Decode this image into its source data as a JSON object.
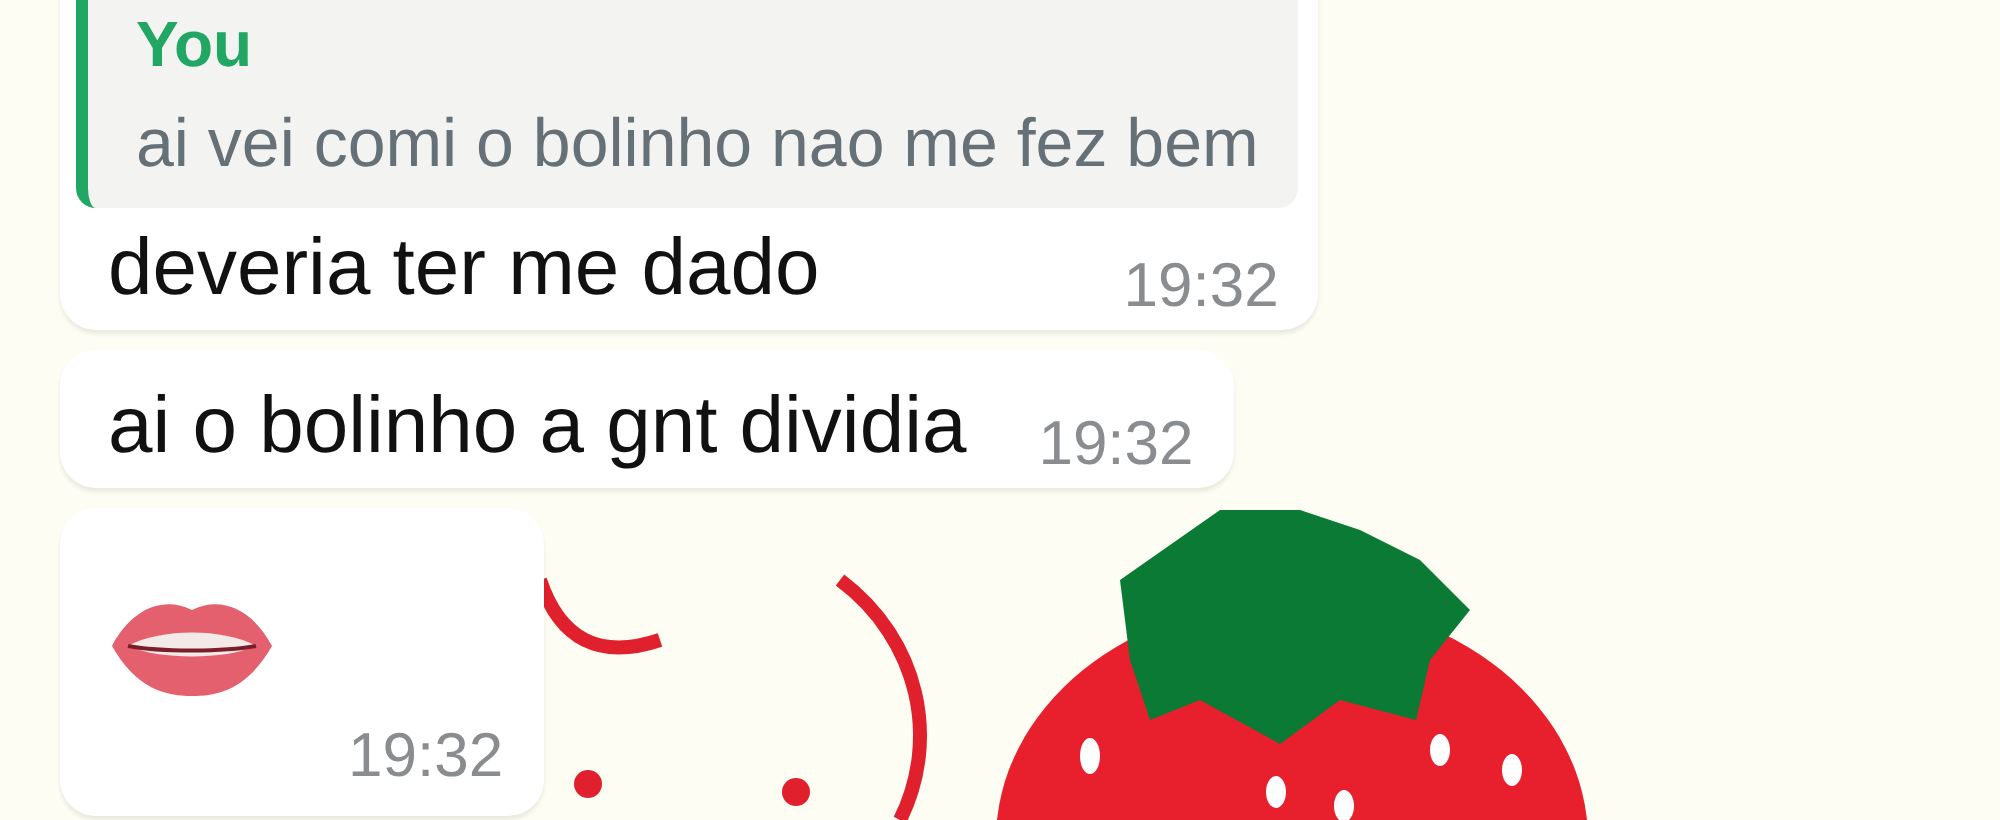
{
  "messages": [
    {
      "kind": "text",
      "quote": {
        "author": "You",
        "text": "ai vei comi o bolinho nao me fez bem"
      },
      "text": "deveria ter me dado",
      "time": "19:32"
    },
    {
      "kind": "text",
      "text": "ai o bolinho a gnt dividia",
      "time": "19:32"
    },
    {
      "kind": "emoji",
      "time": "19:32"
    }
  ]
}
